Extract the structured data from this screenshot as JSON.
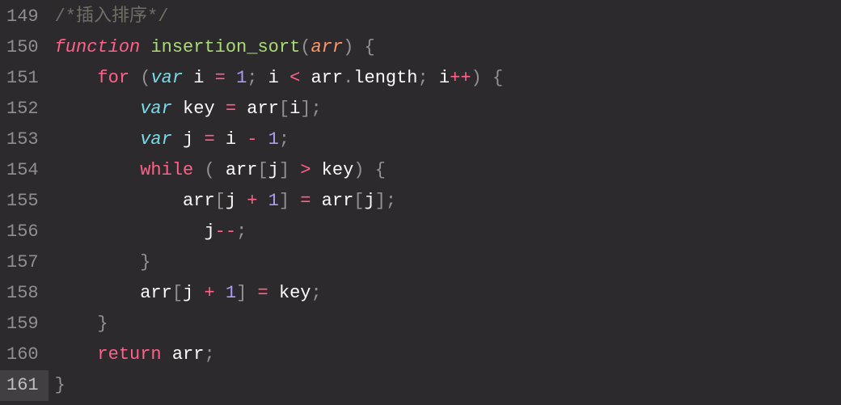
{
  "editor": {
    "language": "javascript",
    "theme": "monokai-pro",
    "startLine": 149,
    "currentLine": 161,
    "lineNumbers": [
      "149",
      "150",
      "151",
      "152",
      "153",
      "154",
      "155",
      "156",
      "157",
      "158",
      "159",
      "160",
      "161"
    ],
    "lines": [
      [
        {
          "t": "comment",
          "v": "/*插入排序*/"
        }
      ],
      [
        {
          "t": "keyword",
          "v": "function"
        },
        {
          "t": "ident",
          "v": " "
        },
        {
          "t": "funcname",
          "v": "insertion_sort"
        },
        {
          "t": "punct",
          "v": "("
        },
        {
          "t": "param",
          "v": "arr"
        },
        {
          "t": "punct",
          "v": ")"
        },
        {
          "t": "ident",
          "v": " "
        },
        {
          "t": "punct",
          "v": "{"
        }
      ],
      [
        {
          "t": "ident",
          "v": "    "
        },
        {
          "t": "keyword-nf",
          "v": "for"
        },
        {
          "t": "ident",
          "v": " "
        },
        {
          "t": "punct",
          "v": "("
        },
        {
          "t": "storage",
          "v": "var"
        },
        {
          "t": "ident",
          "v": " i "
        },
        {
          "t": "operator",
          "v": "="
        },
        {
          "t": "ident",
          "v": " "
        },
        {
          "t": "number",
          "v": "1"
        },
        {
          "t": "punct",
          "v": ";"
        },
        {
          "t": "ident",
          "v": " i "
        },
        {
          "t": "operator",
          "v": "<"
        },
        {
          "t": "ident",
          "v": " arr"
        },
        {
          "t": "punct",
          "v": "."
        },
        {
          "t": "prop",
          "v": "length"
        },
        {
          "t": "punct",
          "v": ";"
        },
        {
          "t": "ident",
          "v": " i"
        },
        {
          "t": "operator",
          "v": "++"
        },
        {
          "t": "punct",
          "v": ")"
        },
        {
          "t": "ident",
          "v": " "
        },
        {
          "t": "punct",
          "v": "{"
        }
      ],
      [
        {
          "t": "ident",
          "v": "        "
        },
        {
          "t": "storage",
          "v": "var"
        },
        {
          "t": "ident",
          "v": " key "
        },
        {
          "t": "operator",
          "v": "="
        },
        {
          "t": "ident",
          "v": " arr"
        },
        {
          "t": "punct",
          "v": "["
        },
        {
          "t": "ident",
          "v": "i"
        },
        {
          "t": "punct",
          "v": "]"
        },
        {
          "t": "punct",
          "v": ";"
        }
      ],
      [
        {
          "t": "ident",
          "v": "        "
        },
        {
          "t": "storage",
          "v": "var"
        },
        {
          "t": "ident",
          "v": " j "
        },
        {
          "t": "operator",
          "v": "="
        },
        {
          "t": "ident",
          "v": " i "
        },
        {
          "t": "operator",
          "v": "-"
        },
        {
          "t": "ident",
          "v": " "
        },
        {
          "t": "number",
          "v": "1"
        },
        {
          "t": "punct",
          "v": ";"
        }
      ],
      [
        {
          "t": "ident",
          "v": "        "
        },
        {
          "t": "keyword-nf",
          "v": "while"
        },
        {
          "t": "ident",
          "v": " "
        },
        {
          "t": "punct",
          "v": "("
        },
        {
          "t": "ident",
          "v": " arr"
        },
        {
          "t": "punct",
          "v": "["
        },
        {
          "t": "ident",
          "v": "j"
        },
        {
          "t": "punct",
          "v": "]"
        },
        {
          "t": "ident",
          "v": " "
        },
        {
          "t": "operator",
          "v": ">"
        },
        {
          "t": "ident",
          "v": " key"
        },
        {
          "t": "punct",
          "v": ")"
        },
        {
          "t": "ident",
          "v": " "
        },
        {
          "t": "punct",
          "v": "{"
        }
      ],
      [
        {
          "t": "ident",
          "v": "            arr"
        },
        {
          "t": "punct",
          "v": "["
        },
        {
          "t": "ident",
          "v": "j "
        },
        {
          "t": "operator",
          "v": "+"
        },
        {
          "t": "ident",
          "v": " "
        },
        {
          "t": "number",
          "v": "1"
        },
        {
          "t": "punct",
          "v": "]"
        },
        {
          "t": "ident",
          "v": " "
        },
        {
          "t": "operator",
          "v": "="
        },
        {
          "t": "ident",
          "v": " arr"
        },
        {
          "t": "punct",
          "v": "["
        },
        {
          "t": "ident",
          "v": "j"
        },
        {
          "t": "punct",
          "v": "]"
        },
        {
          "t": "punct",
          "v": ";"
        }
      ],
      [
        {
          "t": "ident",
          "v": "              j"
        },
        {
          "t": "operator",
          "v": "--"
        },
        {
          "t": "punct",
          "v": ";"
        }
      ],
      [
        {
          "t": "ident",
          "v": "        "
        },
        {
          "t": "punct",
          "v": "}"
        }
      ],
      [
        {
          "t": "ident",
          "v": "        arr"
        },
        {
          "t": "punct",
          "v": "["
        },
        {
          "t": "ident",
          "v": "j "
        },
        {
          "t": "operator",
          "v": "+"
        },
        {
          "t": "ident",
          "v": " "
        },
        {
          "t": "number",
          "v": "1"
        },
        {
          "t": "punct",
          "v": "]"
        },
        {
          "t": "ident",
          "v": " "
        },
        {
          "t": "operator",
          "v": "="
        },
        {
          "t": "ident",
          "v": " key"
        },
        {
          "t": "punct",
          "v": ";"
        }
      ],
      [
        {
          "t": "ident",
          "v": "    "
        },
        {
          "t": "punct",
          "v": "}"
        }
      ],
      [
        {
          "t": "ident",
          "v": "    "
        },
        {
          "t": "keyword-nf",
          "v": "return"
        },
        {
          "t": "ident",
          "v": " arr"
        },
        {
          "t": "punct",
          "v": ";"
        }
      ],
      [
        {
          "t": "punct",
          "v": "}"
        }
      ]
    ]
  },
  "colors": {
    "background": "#2d2a2e",
    "gutter": "#908e8f",
    "comment": "#6e7066",
    "keyword": "#ff6188",
    "storage": "#78dce8",
    "function": "#a9dc76",
    "param": "#fc9867",
    "number": "#ab9df2",
    "punct": "#939293",
    "text": "#fcfcfa"
  }
}
